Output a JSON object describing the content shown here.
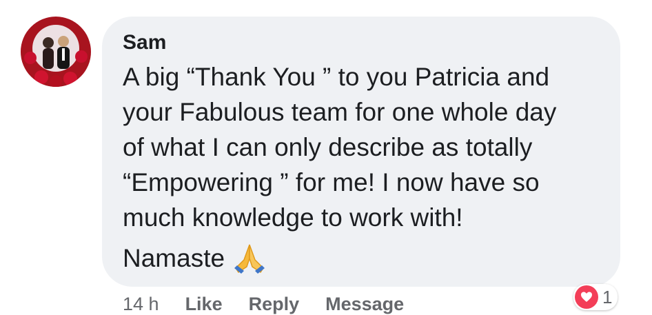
{
  "comment": {
    "author": "Sam",
    "body": "A big “Thank You ” to you Patricia and\nyour Fabulous team for one whole day\nof what I can only describe as totally\n“Empowering ” for me! I now have so\nmuch knowledge to work with!",
    "signoff": "Namaste",
    "signoff_emoji": "folded-hands-icon"
  },
  "actions": {
    "timestamp": "14 h",
    "like_label": "Like",
    "reply_label": "Reply",
    "message_label": "Message"
  },
  "reactions": {
    "icon": "heart-icon",
    "count": "1"
  },
  "colors": {
    "bubble_bg": "#eff1f4",
    "text": "#1c1e21",
    "meta": "#65676b",
    "heart": "#f33e58"
  }
}
